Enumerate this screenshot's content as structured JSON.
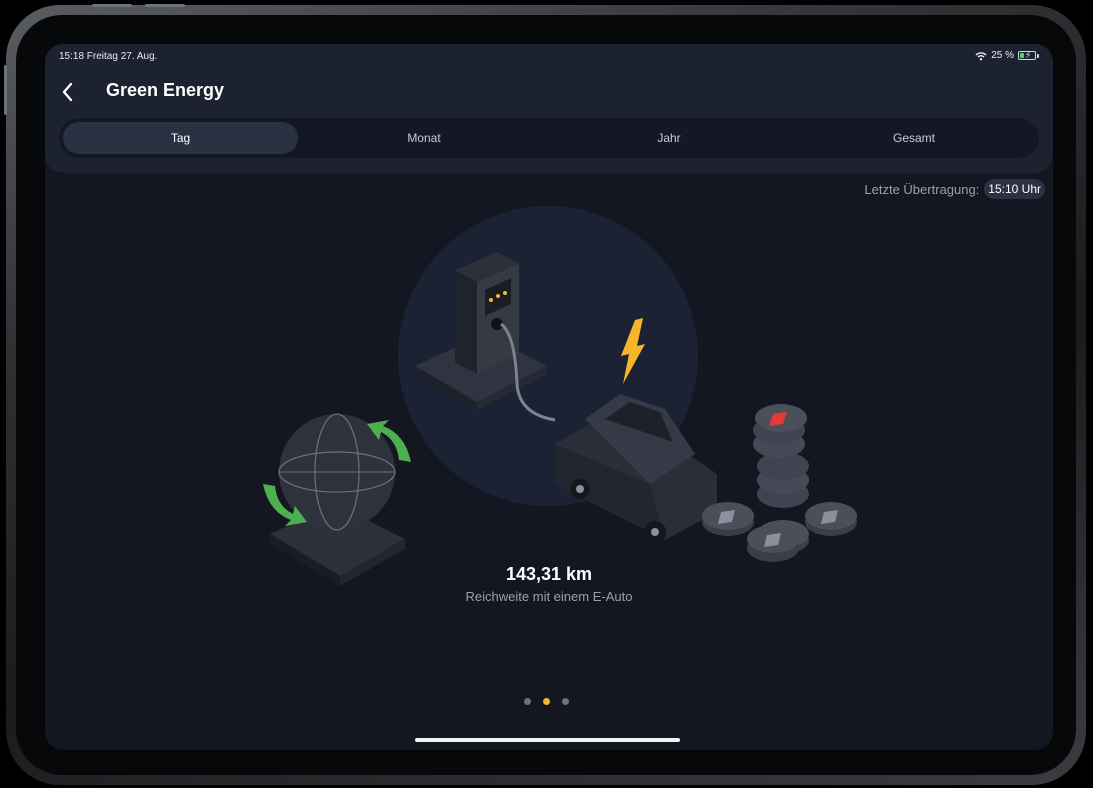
{
  "status_bar": {
    "time_date": "15:18  Freitag 27. Aug.",
    "battery_percent": "25 %",
    "battery_level": 0.25
  },
  "header": {
    "title": "Green Energy"
  },
  "tabs": [
    {
      "label": "Tag",
      "active": true
    },
    {
      "label": "Monat",
      "active": false
    },
    {
      "label": "Jahr",
      "active": false
    },
    {
      "label": "Gesamt",
      "active": false
    }
  ],
  "last_transfer": {
    "label": "Letzte Übertragung:",
    "time": "15:10 Uhr"
  },
  "stat": {
    "value": "143,31 km",
    "caption": "Reichweite mit einem E-Auto"
  },
  "pager": {
    "count": 3,
    "active_index": 1
  },
  "colors": {
    "accent": "#f7b52c",
    "background": "#141722",
    "header": "#1c2230",
    "green_arrow": "#4caf50",
    "coin_mark_red": "#e53935"
  },
  "icons": [
    "back-chevron-icon",
    "wifi-icon",
    "battery-icon",
    "charging-station-icon",
    "electric-car-icon",
    "lightning-bolt-icon",
    "globe-icon",
    "coin-stack-icon"
  ]
}
